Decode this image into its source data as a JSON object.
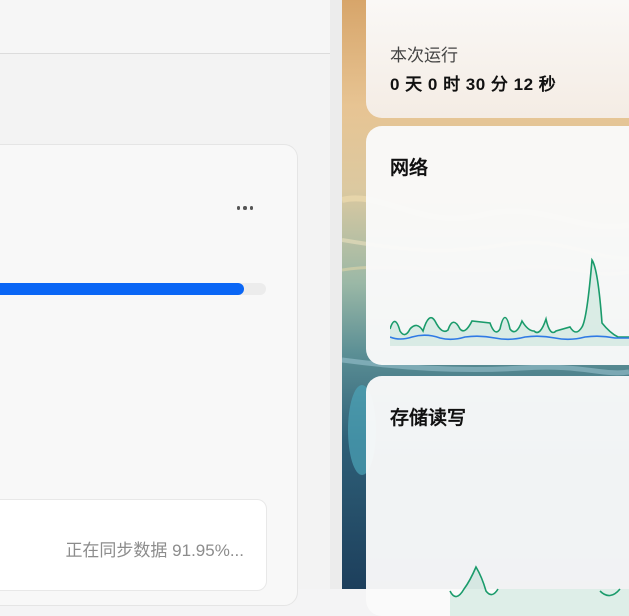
{
  "sync_task": {
    "progress_percent": 91.95,
    "status_text": "正在同步数据 91.95%..."
  },
  "widgets": {
    "uptime": {
      "label": "本次运行",
      "value": "0 天 0 时 30 分 12 秒"
    },
    "network": {
      "title": "网络"
    },
    "storage": {
      "title": "存储读写"
    }
  },
  "colors": {
    "accent": "#0a66f5",
    "chart_green": "#1a9b6b",
    "chart_blue": "#2f7ae5"
  }
}
